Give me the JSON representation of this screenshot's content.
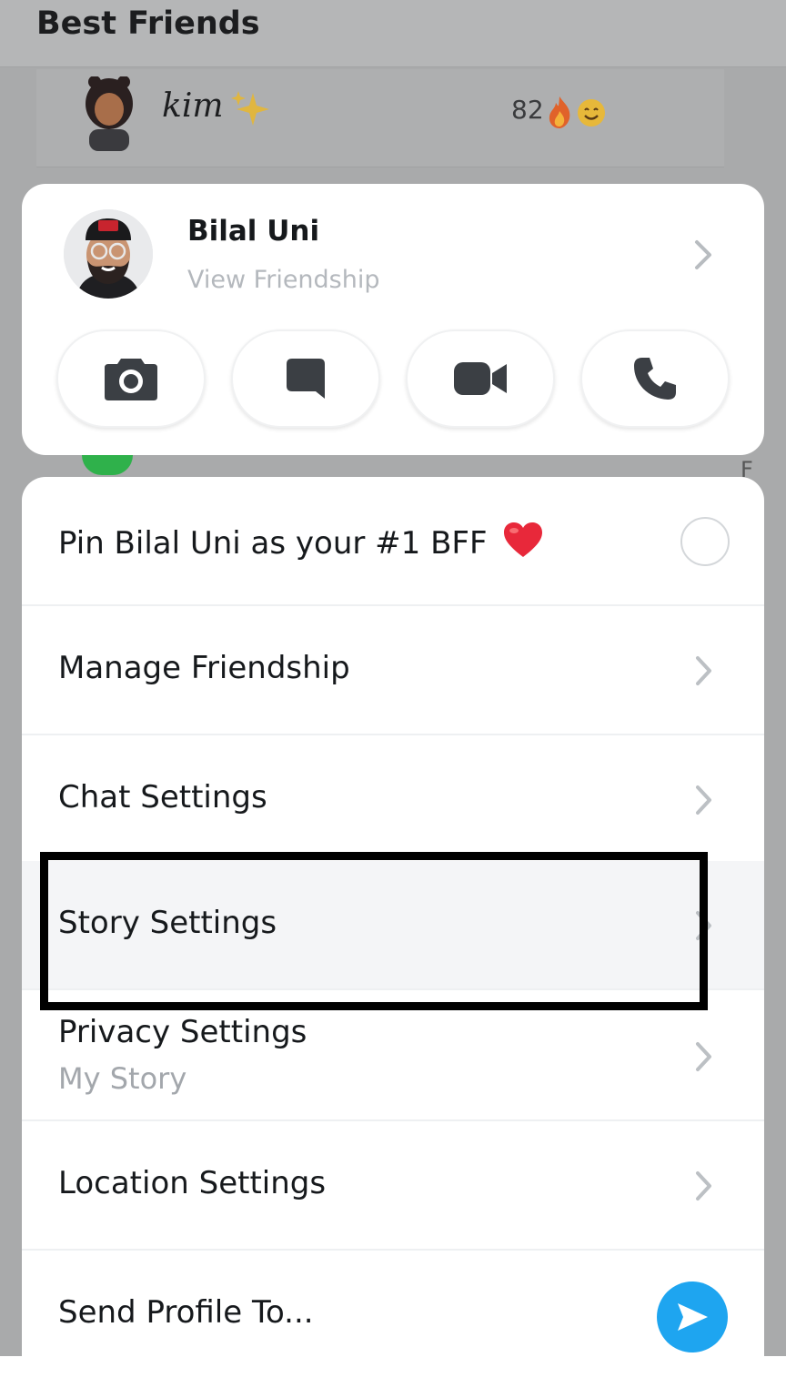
{
  "background": {
    "header_title": "Best Friends",
    "row": {
      "name": "kim",
      "streak_count": "82"
    },
    "edge_letter": "F"
  },
  "friend_card": {
    "name": "Bilal Uni",
    "subtitle": "View Friendship",
    "actions": [
      "camera",
      "chat",
      "video-call",
      "voice-call"
    ]
  },
  "menu": {
    "pin_label": "Pin Bilal Uni as your #1 BFF",
    "manage_label": "Manage Friendship",
    "chat_label": "Chat Settings",
    "story_label": "Story Settings",
    "privacy_label": "Privacy Settings",
    "privacy_sub": "My Story",
    "location_label": "Location Settings",
    "send_label": "Send Profile To..."
  },
  "colors": {
    "accent_blue": "#1ea5f0",
    "annotation": "#000000",
    "heart": "#e8283a"
  }
}
